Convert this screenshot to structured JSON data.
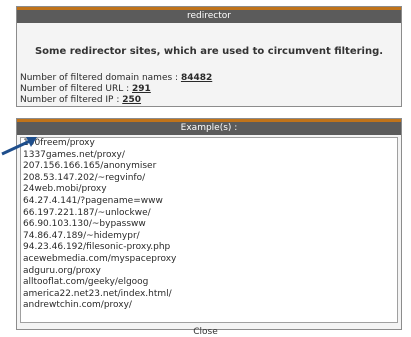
{
  "top_panel": {
    "title": "redirector",
    "description": "Some redirector sites, which are used to circumvent filtering.",
    "stats": [
      {
        "label": "Number of filtered domain names : ",
        "value": "84482"
      },
      {
        "label": "Number of filtered URL : ",
        "value": "291"
      },
      {
        "label": "Number of filtered IP : ",
        "value": "250"
      }
    ]
  },
  "examples": {
    "title": "Example(s) :",
    "items": [
      "100freem/proxy",
      "1337games.net/proxy/",
      "207.156.166.165/anonymiser",
      "208.53.147.202/~regvinfo/",
      "24web.mobi/proxy",
      "64.27.4.141/?pagename=www",
      "66.197.221.187/~unlockwe/",
      "66.90.103.130/~bypassww",
      "74.86.47.189/~hidemypr/",
      "94.23.46.192/filesonic-proxy.php",
      "acewebmedia.com/myspaceproxy",
      "adguru.org/proxy",
      "alltooflat.com/geeky/elgoog",
      "america22.net23.net/index.html/",
      "andrewtchin.com/proxy/"
    ]
  },
  "close_label": "Close",
  "colors": {
    "title_bar": "#5b5b5b",
    "title_accent": "#c0731a",
    "panel_bg": "#f4f4f4",
    "arrow": "#1e4e8c"
  }
}
